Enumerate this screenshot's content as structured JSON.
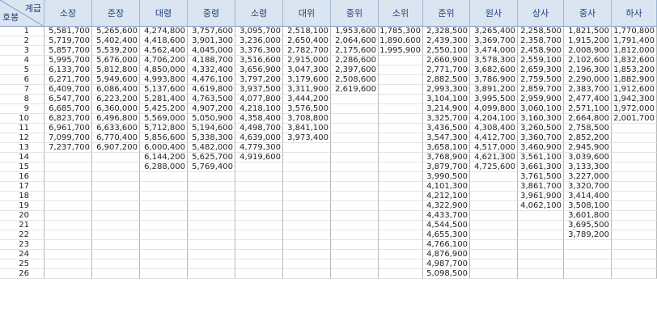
{
  "corner": {
    "top_label": "계급",
    "bottom_label": "호봉"
  },
  "columns": [
    "소장",
    "준장",
    "대령",
    "중령",
    "소령",
    "대위",
    "중위",
    "소위",
    "준위",
    "원사",
    "상사",
    "중사",
    "하사"
  ],
  "rows": [
    {
      "step": "1",
      "values": [
        "5,581,700",
        "5,265,600",
        "4,274,800",
        "3,757,600",
        "3,095,700",
        "2,518,100",
        "1,953,600",
        "1,785,300",
        "2,328,500",
        "3,265,400",
        "2,258,500",
        "1,821,500",
        "1,770,800"
      ]
    },
    {
      "step": "2",
      "values": [
        "5,719,700",
        "5,402,400",
        "4,418,600",
        "3,901,300",
        "3,236,000",
        "2,650,400",
        "2,064,600",
        "1,890,600",
        "2,439,300",
        "3,369,700",
        "2,358,700",
        "1,915,200",
        "1,791,400"
      ]
    },
    {
      "step": "3",
      "values": [
        "5,857,700",
        "5,539,200",
        "4,562,400",
        "4,045,000",
        "3,376,300",
        "2,782,700",
        "2,175,600",
        "1,995,900",
        "2,550,100",
        "3,474,000",
        "2,458,900",
        "2,008,900",
        "1,812,000"
      ]
    },
    {
      "step": "4",
      "values": [
        "5,995,700",
        "5,676,000",
        "4,706,200",
        "4,188,700",
        "3,516,600",
        "2,915,000",
        "2,286,600",
        "",
        "2,660,900",
        "3,578,300",
        "2,559,100",
        "2,102,600",
        "1,832,600"
      ]
    },
    {
      "step": "5",
      "values": [
        "6,133,700",
        "5,812,800",
        "4,850,000",
        "4,332,400",
        "3,656,900",
        "3,047,300",
        "2,397,600",
        "",
        "2,771,700",
        "3,682,600",
        "2,659,300",
        "2,196,300",
        "1,853,200"
      ]
    },
    {
      "step": "6",
      "values": [
        "6,271,700",
        "5,949,600",
        "4,993,800",
        "4,476,100",
        "3,797,200",
        "3,179,600",
        "2,508,600",
        "",
        "2,882,500",
        "3,786,900",
        "2,759,500",
        "2,290,000",
        "1,882,900"
      ]
    },
    {
      "step": "7",
      "values": [
        "6,409,700",
        "6,086,400",
        "5,137,600",
        "4,619,800",
        "3,937,500",
        "3,311,900",
        "2,619,600",
        "",
        "2,993,300",
        "3,891,200",
        "2,859,700",
        "2,383,700",
        "1,912,600"
      ]
    },
    {
      "step": "8",
      "values": [
        "6,547,700",
        "6,223,200",
        "5,281,400",
        "4,763,500",
        "4,077,800",
        "3,444,200",
        "",
        "",
        "3,104,100",
        "3,995,500",
        "2,959,900",
        "2,477,400",
        "1,942,300"
      ]
    },
    {
      "step": "9",
      "values": [
        "6,685,700",
        "6,360,000",
        "5,425,200",
        "4,907,200",
        "4,218,100",
        "3,576,500",
        "",
        "",
        "3,214,900",
        "4,099,800",
        "3,060,100",
        "2,571,100",
        "1,972,000"
      ]
    },
    {
      "step": "10",
      "values": [
        "6,823,700",
        "6,496,800",
        "5,569,000",
        "5,050,900",
        "4,358,400",
        "3,708,800",
        "",
        "",
        "3,325,700",
        "4,204,100",
        "3,160,300",
        "2,664,800",
        "2,001,700"
      ]
    },
    {
      "step": "11",
      "values": [
        "6,961,700",
        "6,633,600",
        "5,712,800",
        "5,194,600",
        "4,498,700",
        "3,841,100",
        "",
        "",
        "3,436,500",
        "4,308,400",
        "3,260,500",
        "2,758,500",
        ""
      ]
    },
    {
      "step": "12",
      "values": [
        "7,099,700",
        "6,770,400",
        "5,856,600",
        "5,338,300",
        "4,639,000",
        "3,973,400",
        "",
        "",
        "3,547,300",
        "4,412,700",
        "3,360,700",
        "2,852,200",
        ""
      ]
    },
    {
      "step": "13",
      "values": [
        "7,237,700",
        "6,907,200",
        "6,000,400",
        "5,482,000",
        "4,779,300",
        "",
        "",
        "",
        "3,658,100",
        "4,517,000",
        "3,460,900",
        "2,945,900",
        ""
      ]
    },
    {
      "step": "14",
      "values": [
        "",
        "",
        "6,144,200",
        "5,625,700",
        "4,919,600",
        "",
        "",
        "",
        "3,768,900",
        "4,621,300",
        "3,561,100",
        "3,039,600",
        ""
      ]
    },
    {
      "step": "15",
      "values": [
        "",
        "",
        "6,288,000",
        "5,769,400",
        "",
        "",
        "",
        "",
        "3,879,700",
        "4,725,600",
        "3,661,300",
        "3,133,300",
        ""
      ]
    },
    {
      "step": "16",
      "values": [
        "",
        "",
        "",
        "",
        "",
        "",
        "",
        "",
        "3,990,500",
        "",
        "3,761,500",
        "3,227,000",
        ""
      ]
    },
    {
      "step": "17",
      "values": [
        "",
        "",
        "",
        "",
        "",
        "",
        "",
        "",
        "4,101,300",
        "",
        "3,861,700",
        "3,320,700",
        ""
      ]
    },
    {
      "step": "18",
      "values": [
        "",
        "",
        "",
        "",
        "",
        "",
        "",
        "",
        "4,212,100",
        "",
        "3,961,900",
        "3,414,400",
        ""
      ]
    },
    {
      "step": "19",
      "values": [
        "",
        "",
        "",
        "",
        "",
        "",
        "",
        "",
        "4,322,900",
        "",
        "4,062,100",
        "3,508,100",
        ""
      ]
    },
    {
      "step": "20",
      "values": [
        "",
        "",
        "",
        "",
        "",
        "",
        "",
        "",
        "4,433,700",
        "",
        "",
        "3,601,800",
        ""
      ]
    },
    {
      "step": "21",
      "values": [
        "",
        "",
        "",
        "",
        "",
        "",
        "",
        "",
        "4,544,500",
        "",
        "",
        "3,695,500",
        ""
      ]
    },
    {
      "step": "22",
      "values": [
        "",
        "",
        "",
        "",
        "",
        "",
        "",
        "",
        "4,655,300",
        "",
        "",
        "3,789,200",
        ""
      ]
    },
    {
      "step": "23",
      "values": [
        "",
        "",
        "",
        "",
        "",
        "",
        "",
        "",
        "4,766,100",
        "",
        "",
        "",
        ""
      ]
    },
    {
      "step": "24",
      "values": [
        "",
        "",
        "",
        "",
        "",
        "",
        "",
        "",
        "4,876,900",
        "",
        "",
        "",
        ""
      ]
    },
    {
      "step": "25",
      "values": [
        "",
        "",
        "",
        "",
        "",
        "",
        "",
        "",
        "4,987,700",
        "",
        "",
        "",
        ""
      ]
    },
    {
      "step": "26",
      "values": [
        "",
        "",
        "",
        "",
        "",
        "",
        "",
        "",
        "5,098,500",
        "",
        "",
        "",
        ""
      ]
    }
  ]
}
